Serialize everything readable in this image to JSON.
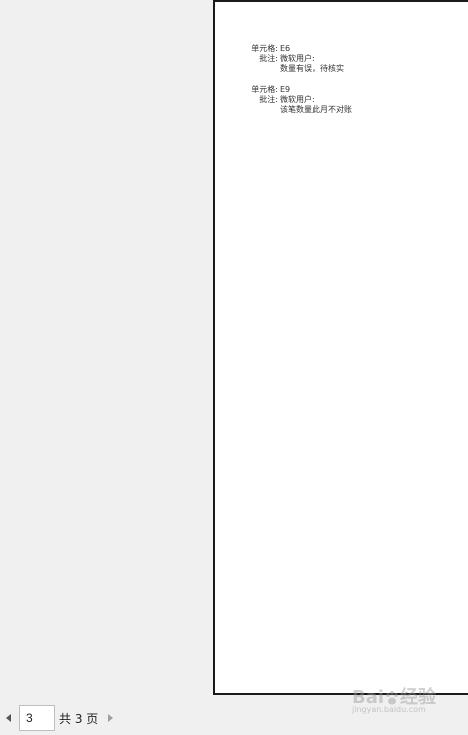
{
  "comments": [
    {
      "cell_label": "单元格:",
      "cell_ref": "E6",
      "note_label": "批注:",
      "author": "微软用户:",
      "text": "数量有误，待核实"
    },
    {
      "cell_label": "单元格:",
      "cell_ref": "E9",
      "note_label": "批注:",
      "author": "微软用户:",
      "text": "该笔数量此月不对账"
    }
  ],
  "pager": {
    "current_page": "3",
    "total_label": "共 3 页"
  },
  "watermark": {
    "brand_left": "Bai",
    "brand_right": "经验",
    "url": "jingyan.baidu.com"
  }
}
